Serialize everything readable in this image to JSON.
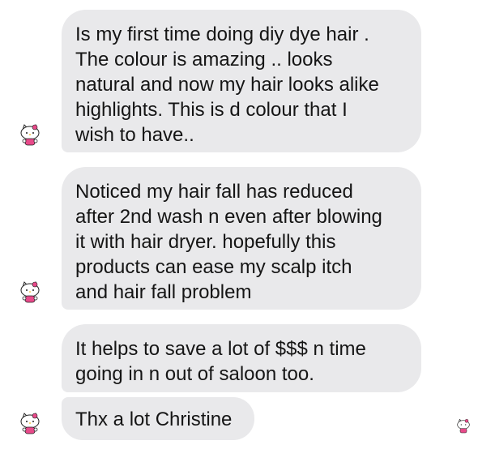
{
  "conversation": {
    "messages": [
      {
        "text": "Is my first time doing diy dye hair .\nThe colour is amazing .. looks\nnatural and now my hair looks alike\nhighlights. This is d colour that I\nwish to have.."
      },
      {
        "text": "Noticed my hair fall has reduced\nafter 2nd wash n even after blowing\nit with hair dryer. hopefully this\nproducts can ease my scalp itch\nand hair fall problem"
      },
      {
        "text": "It helps to save a lot of $$$ n time\ngoing in n out of saloon too."
      },
      {
        "text": "Thx a lot Christine"
      }
    ],
    "avatar_icon": "hello-kitty-avatar-icon",
    "seen_indicator_icon": "hello-kitty-seen-icon"
  },
  "colors": {
    "bubble_background": "#e9e9eb",
    "text": "#151515",
    "page_background": "#ffffff"
  }
}
